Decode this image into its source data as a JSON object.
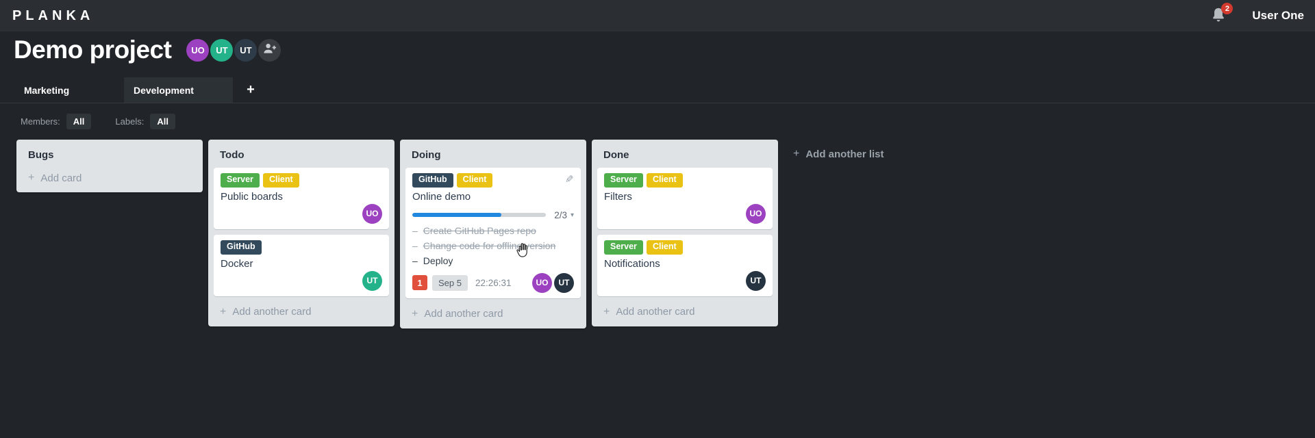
{
  "topbar": {
    "logo": "PLANKA",
    "notification_count": "2",
    "user_name": "User One"
  },
  "project": {
    "title": "Demo project",
    "members": [
      {
        "initials": "UO",
        "color": "#9c41bf"
      },
      {
        "initials": "UT",
        "color": "#23b28a"
      },
      {
        "initials": "UT",
        "color": "#2e3c4a"
      }
    ]
  },
  "tabs": [
    {
      "label": "Marketing",
      "active": false
    },
    {
      "label": "Development",
      "active": true
    }
  ],
  "filters": {
    "members_label": "Members:",
    "members_value": "All",
    "labels_label": "Labels:",
    "labels_value": "All"
  },
  "board": {
    "add_list_label": "Add another list",
    "lists": [
      {
        "name": "Bugs",
        "add_card_label": "Add card",
        "cards": []
      },
      {
        "name": "Todo",
        "add_card_label": "Add another card",
        "cards": [
          {
            "title": "Public boards",
            "labels": [
              {
                "text": "Server",
                "color": "#4fae4c"
              },
              {
                "text": "Client",
                "color": "#e9c213"
              }
            ],
            "members": [
              {
                "initials": "UO",
                "color": "#9c41bf"
              }
            ]
          },
          {
            "title": "Docker",
            "labels": [
              {
                "text": "GitHub",
                "color": "#33495c"
              }
            ],
            "members": [
              {
                "initials": "UT",
                "color": "#23b28a"
              }
            ]
          }
        ]
      },
      {
        "name": "Doing",
        "add_card_label": "Add another card",
        "cards": [
          {
            "title": "Online demo",
            "labels": [
              {
                "text": "GitHub",
                "color": "#33495c"
              },
              {
                "text": "Client",
                "color": "#e9c213"
              }
            ],
            "progress": {
              "completed": 2,
              "total": 3,
              "label": "2/3",
              "bar_color": "#2188e0"
            },
            "tasks": [
              {
                "text": "Create GitHub Pages repo",
                "done": true
              },
              {
                "text": "Change code for offline version",
                "done": true
              },
              {
                "text": "Deploy",
                "done": false
              }
            ],
            "notification_count": "1",
            "due_date": "Sep 5",
            "stopwatch": "22:26:31",
            "members": [
              {
                "initials": "UO",
                "color": "#9c41bf"
              },
              {
                "initials": "UT",
                "color": "#263340"
              }
            ]
          }
        ]
      },
      {
        "name": "Done",
        "add_card_label": "Add another card",
        "cards": [
          {
            "title": "Filters",
            "labels": [
              {
                "text": "Server",
                "color": "#4fae4c"
              },
              {
                "text": "Client",
                "color": "#e9c213"
              }
            ],
            "members": [
              {
                "initials": "UO",
                "color": "#9c41bf"
              }
            ]
          },
          {
            "title": "Notifications",
            "labels": [
              {
                "text": "Server",
                "color": "#4fae4c"
              },
              {
                "text": "Client",
                "color": "#e9c213"
              }
            ],
            "members": [
              {
                "initials": "UT",
                "color": "#263340"
              }
            ]
          }
        ]
      }
    ]
  }
}
